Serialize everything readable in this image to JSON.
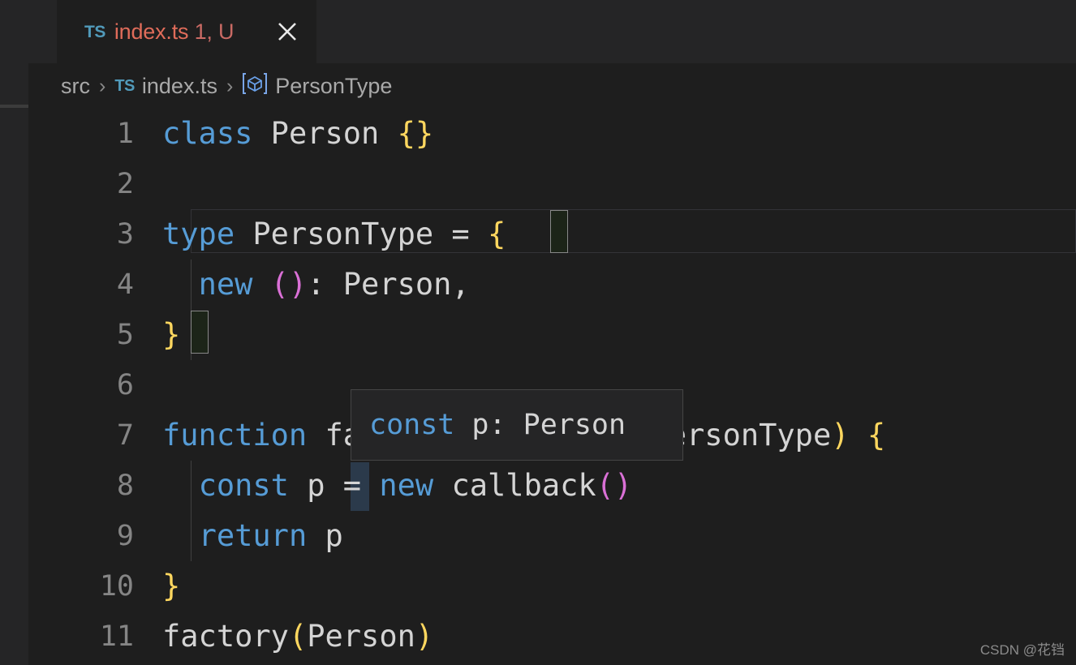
{
  "tab": {
    "file_icon_label": "TS",
    "title": "index.ts",
    "badge": "1, U",
    "close_icon": "close-icon"
  },
  "breadcrumb": {
    "folder": "src",
    "file_icon_label": "TS",
    "file": "index.ts",
    "symbol_icon": "interface-icon",
    "symbol": "PersonType",
    "separator": "›"
  },
  "editor": {
    "line_numbers": [
      "1",
      "2",
      "3",
      "4",
      "5",
      "6",
      "7",
      "8",
      "9",
      "10",
      "11"
    ],
    "lines": [
      {
        "n": "1",
        "raw": "class Person {}"
      },
      {
        "n": "2",
        "raw": ""
      },
      {
        "n": "3",
        "raw": "type PersonType = {"
      },
      {
        "n": "4",
        "raw": "  new (): Person,"
      },
      {
        "n": "5",
        "raw": "}"
      },
      {
        "n": "6",
        "raw": ""
      },
      {
        "n": "7",
        "raw": "function factory(callback: PersonType) {"
      },
      {
        "n": "8",
        "raw": "  const p = new callback()"
      },
      {
        "n": "9",
        "raw": "  return p"
      },
      {
        "n": "10",
        "raw": "}"
      },
      {
        "n": "11",
        "raw": "factory(Person)"
      }
    ],
    "tokens": {
      "l1_kw": "class",
      "l1_name": " Person ",
      "l1_brace": "{}",
      "l3_kw": "type",
      "l3_name": " PersonType = ",
      "l3_brace": "{",
      "l4_indent": "  ",
      "l4_kw": "new",
      "l4_paren": "()",
      "l4_rest": ": Person,",
      "l5_brace": "}",
      "l7_kw": "function",
      "l7_name": " factory",
      "l7_paren_open": "(",
      "l7_args": "callback: PersonType",
      "l7_paren_close": ")",
      "l7_space": " ",
      "l7_brace": "{",
      "l8_indent": "  ",
      "l8_kw": "const",
      "l8_var": " p = ",
      "l8_kw2": "new",
      "l8_call": " callback",
      "l8_paren": "()",
      "l9_indent": "  ",
      "l9_kw": "return",
      "l9_var": " p",
      "l10_brace": "}",
      "l11_name": "factory",
      "l11_paren_open": "(",
      "l11_arg": "Person",
      "l11_paren_close": ")"
    },
    "current_line": "3"
  },
  "hover": {
    "keyword": "const",
    "text": " p: Person"
  },
  "watermark": "CSDN @花铛",
  "colors": {
    "editor_background": "#1e1e1e",
    "chrome_background": "#252526",
    "keyword_blue": "#569cd6",
    "plain_text": "#d4d4d4",
    "bracket_yellow": "#ffd75f",
    "bracket_magenta": "#da70d6",
    "tab_title_red": "#e06c5a",
    "ts_icon_blue": "#519aba",
    "line_number": "#858585",
    "breadcrumb_text": "#a9a9a9",
    "hover_border": "#454545",
    "bracket_match_border": "#888888",
    "word_highlight": "#2b3a4b"
  }
}
